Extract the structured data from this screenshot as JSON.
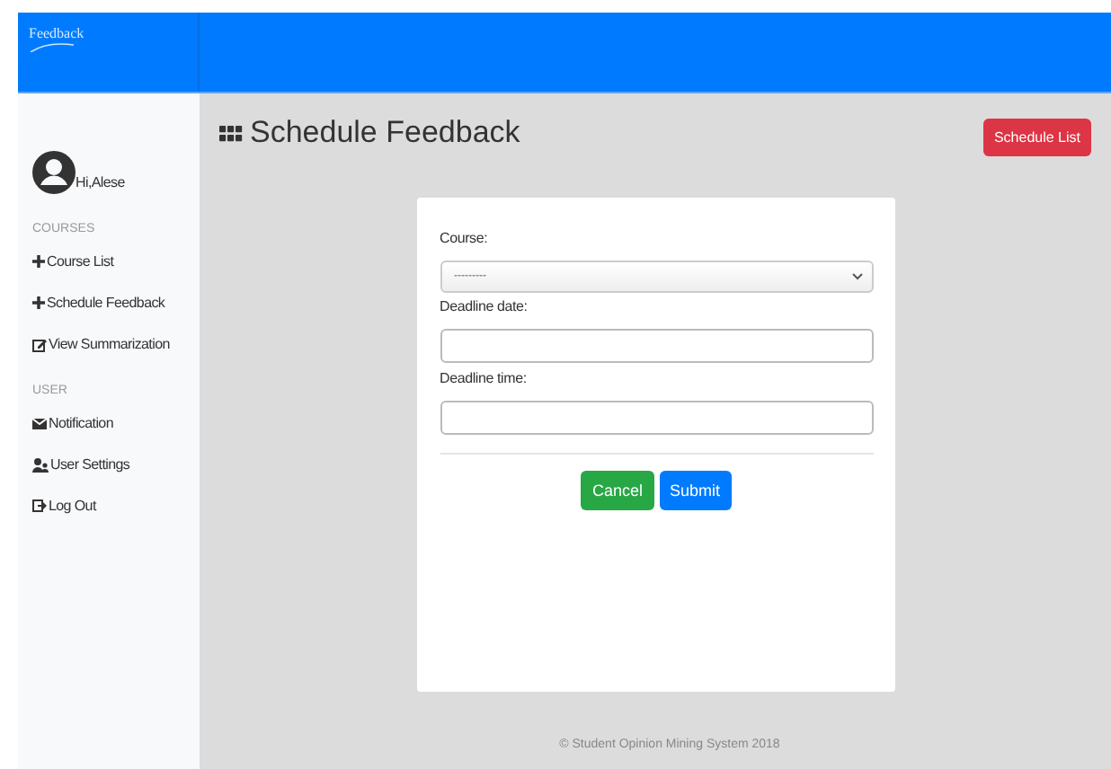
{
  "brand": "Feedback",
  "user": {
    "greeting": "Hi,Alese"
  },
  "sidebar": {
    "sections": [
      {
        "heading": "COURSES",
        "items": [
          {
            "label": "Course List"
          },
          {
            "label": "Schedule Feedback"
          },
          {
            "label": "View Summarization"
          }
        ]
      },
      {
        "heading": "USER",
        "items": [
          {
            "label": "Notification"
          },
          {
            "label": "User Settings"
          },
          {
            "label": "Log Out"
          }
        ]
      }
    ]
  },
  "page": {
    "title": "Schedule Feedback",
    "action": "Schedule List"
  },
  "form": {
    "fields": [
      {
        "kind": "select",
        "label": "Course:",
        "value": "---------"
      },
      {
        "kind": "text",
        "label": "Deadline date:"
      },
      {
        "kind": "text",
        "label": "Deadline time:"
      }
    ],
    "buttons": [
      {
        "kind": "cancel",
        "label": "Cancel"
      },
      {
        "kind": "submit",
        "label": "Submit"
      }
    ]
  },
  "footer": "© Student Opinion Mining System 2018"
}
